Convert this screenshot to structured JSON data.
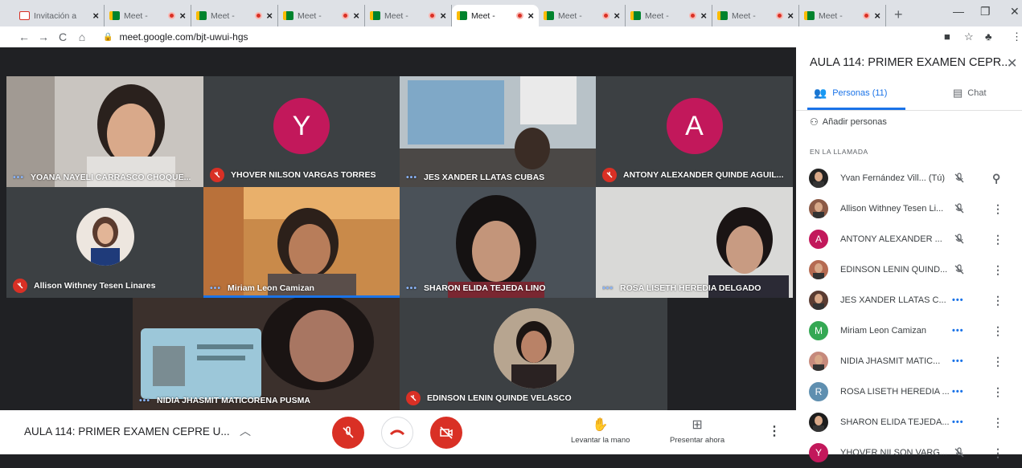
{
  "browser": {
    "tabs": [
      {
        "title": "Invitación a",
        "icon": "gmail-icon"
      },
      {
        "title": "Meet -",
        "icon": "meet-icon"
      },
      {
        "title": "Meet -",
        "icon": "meet-icon"
      },
      {
        "title": "Meet -",
        "icon": "meet-icon"
      },
      {
        "title": "Meet -",
        "icon": "meet-icon"
      },
      {
        "title": "Meet -",
        "icon": "meet-icon"
      },
      {
        "title": "Meet -",
        "icon": "meet-icon"
      },
      {
        "title": "Meet -",
        "icon": "meet-icon"
      },
      {
        "title": "Meet -",
        "icon": "meet-icon"
      },
      {
        "title": "Meet -",
        "icon": "meet-icon"
      }
    ],
    "new_tab": "+",
    "url": "meet.google.com/bjt-uwui-hgs"
  },
  "grid": {
    "tiles": [
      {
        "name": "YOANA NAYELI CARRASCO CHOQUE...",
        "muted": false
      },
      {
        "name": "YHOVER NILSON VARGAS TORRES",
        "muted": true,
        "initial": "Y",
        "color": "#c2185b"
      },
      {
        "name": "JES XANDER LLATAS CUBAS",
        "muted": false
      },
      {
        "name": "ANTONY ALEXANDER QUINDE AGUIL...",
        "muted": true,
        "initial": "A",
        "color": "#c2185b"
      },
      {
        "name": "Allison Withney Tesen Linares",
        "muted": true
      },
      {
        "name": "Miriam Leon Camizan",
        "muted": false
      },
      {
        "name": "SHARON ELIDA TEJEDA LINO",
        "muted": false
      },
      {
        "name": "ROSA LISETH HEREDIA DELGADO",
        "muted": false
      },
      {
        "name": "NIDIA JHASMIT MATICORENA PUSMA",
        "muted": false
      },
      {
        "name": "EDINSON LENIN QUINDE VELASCO",
        "muted": true
      }
    ]
  },
  "controls": {
    "meeting_title": "AULA 114: PRIMER EXAMEN CEPRE U...",
    "raise_hand": "Levantar la mano",
    "present": "Presentar ahora"
  },
  "panel": {
    "title": "AULA 114: PRIMER EXAMEN CEPR...",
    "tab_people": "Personas (11)",
    "tab_chat": "Chat",
    "add_people": "Añadir personas",
    "section": "EN LA LLAMADA",
    "participants": [
      {
        "name": "Yvan Fernández Vill... (Tú)",
        "status": "muted",
        "extra": "pin"
      },
      {
        "name": "Allison Withney Tesen Li...",
        "status": "muted"
      },
      {
        "name": "ANTONY ALEXANDER ...",
        "status": "muted",
        "initial": "A",
        "color": "#c2185b"
      },
      {
        "name": "EDINSON LENIN QUIND...",
        "status": "muted"
      },
      {
        "name": "JES XANDER LLATAS C...",
        "status": "speaking"
      },
      {
        "name": "Miriam Leon Camizan",
        "status": "speaking",
        "initial": "M",
        "color": "#34a853"
      },
      {
        "name": "NIDIA JHASMIT MATIC...",
        "status": "speaking"
      },
      {
        "name": "ROSA LISETH HEREDIA ...",
        "status": "speaking",
        "initial": "R",
        "color": "#5f8fb0"
      },
      {
        "name": "SHARON ELIDA TEJEDA...",
        "status": "speaking"
      },
      {
        "name": "YHOVER NILSON VARG...",
        "status": "muted",
        "initial": "Y",
        "color": "#c2185b"
      }
    ]
  }
}
